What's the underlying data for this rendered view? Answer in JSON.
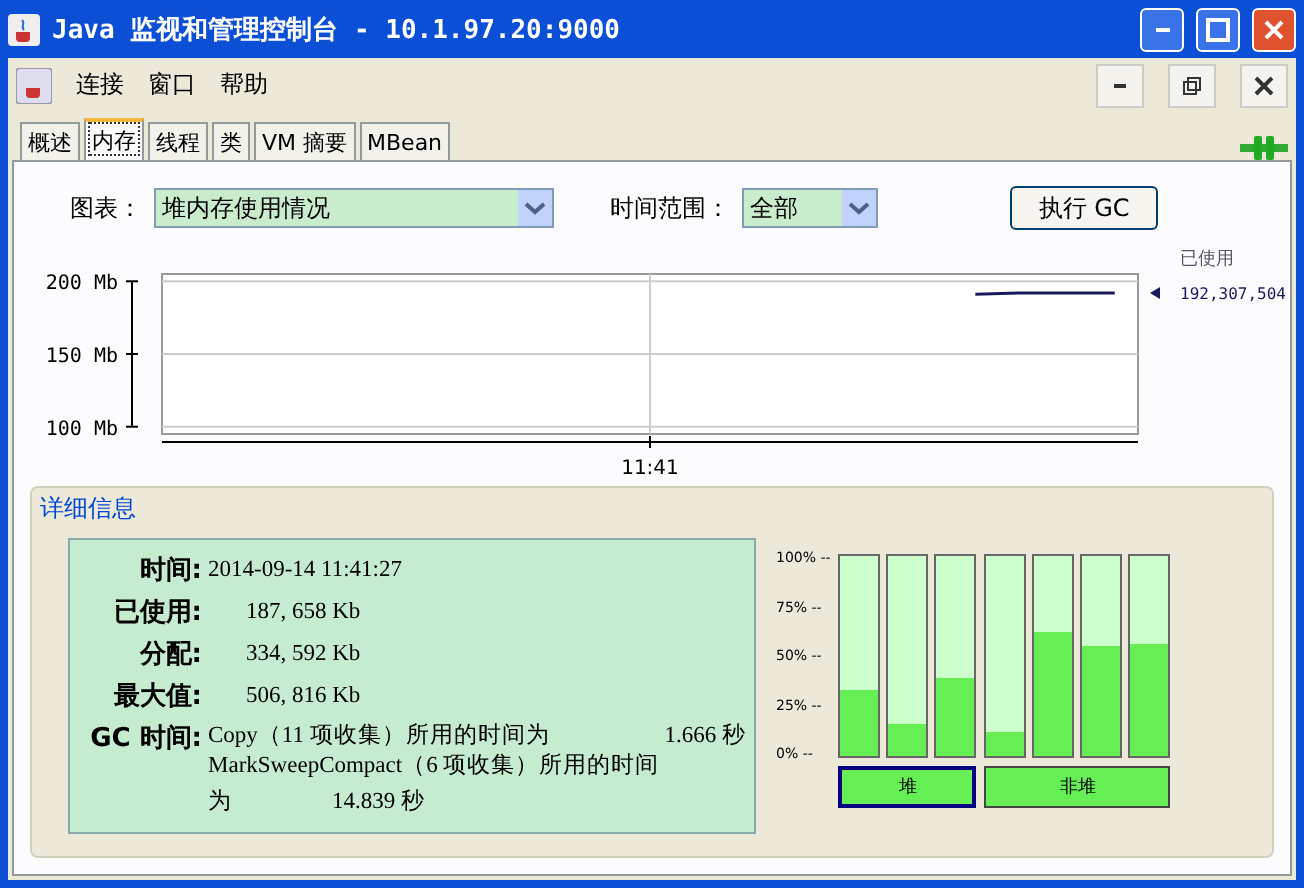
{
  "window": {
    "title": "Java 监视和管理控制台 - 10.1.97.20:9000"
  },
  "menu": [
    "连接",
    "窗口",
    "帮助"
  ],
  "tabs": [
    {
      "label": "概述",
      "selected": false
    },
    {
      "label": "内存",
      "selected": true
    },
    {
      "label": "线程",
      "selected": false
    },
    {
      "label": "类",
      "selected": false
    },
    {
      "label": "VM 摘要",
      "selected": false
    },
    {
      "label": "MBean",
      "selected": false
    }
  ],
  "controls": {
    "chart_label": "图表：",
    "chart_value": "堆内存使用情况",
    "range_label": "时间范围：",
    "range_value": "全部",
    "gc_button": "执行 GC"
  },
  "chart": {
    "legend_value": "192,307,504",
    "chart_data": {
      "type": "line",
      "grid": true,
      "annotations": [
        {
          "text": "11:41"
        }
      ],
      "ylim": [
        95,
        205
      ],
      "yticks": [
        {
          "value": 100,
          "label": "100 Mb"
        },
        {
          "value": 150,
          "label": "150 Mb"
        },
        {
          "value": 200,
          "label": "200 Mb"
        }
      ],
      "series": [
        {
          "name": "已使用",
          "color": "#1a1a5e",
          "values": [
            null,
            null,
            null,
            null,
            null,
            null,
            null,
            null,
            null,
            null,
            null,
            null,
            null,
            null,
            null,
            null,
            null,
            191,
            192,
            192,
            192
          ]
        }
      ]
    }
  },
  "details": {
    "title": "详细信息",
    "fields": [
      {
        "label": "时间:",
        "value": "2014-09-14 11:41:27"
      },
      {
        "label": "已使用:",
        "value": "187, 658 Kb"
      },
      {
        "label": "分配:",
        "value": "334, 592 Kb"
      },
      {
        "label": "最大值:",
        "value": "506, 816 Kb"
      }
    ],
    "gc_label": "GC 时间:",
    "gc_lines": [
      {
        "text": "Copy（11 项收集）所用的时间为",
        "time": "1.666 秒"
      },
      {
        "text": "MarkSweepCompact（6 项收集）所用的时间"
      }
    ],
    "gc_tail": {
      "text": "为",
      "time": "14.839 秒"
    }
  },
  "pools": {
    "scale": [
      "100% --",
      "75% --",
      "50% --",
      "25% --",
      "0% --"
    ],
    "groups": [
      {
        "label": "堆",
        "selected": true,
        "bars": [
          {
            "level": 0.33
          },
          {
            "level": 0.16
          },
          {
            "level": 0.39
          }
        ]
      },
      {
        "label": "非堆",
        "selected": false,
        "bars": [
          {
            "level": 0.12
          },
          {
            "level": 0.62
          },
          {
            "level": 0.55
          },
          {
            "level": 0.56
          }
        ]
      }
    ]
  }
}
